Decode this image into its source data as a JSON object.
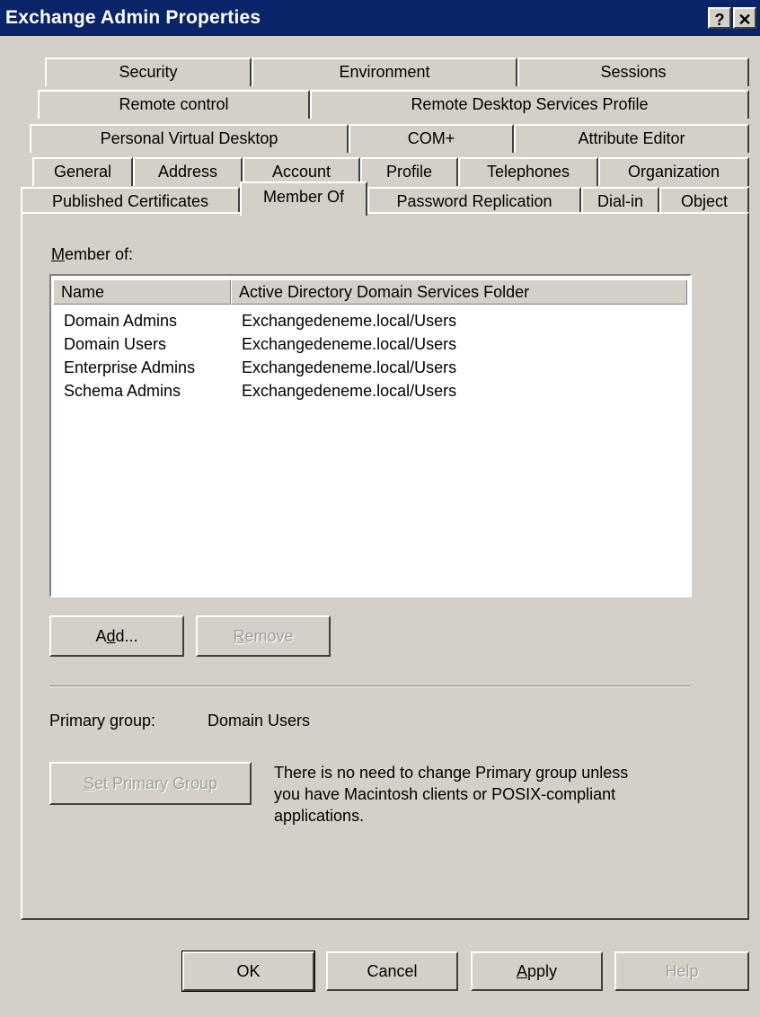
{
  "window": {
    "title": "Exchange Admin Properties",
    "help_glyph": "?",
    "close_glyph": "✕"
  },
  "tabs": {
    "row1": [
      "Security",
      "Environment",
      "Sessions"
    ],
    "row2": [
      "Remote control",
      "Remote Desktop Services Profile"
    ],
    "row3": [
      "Personal Virtual Desktop",
      "COM+",
      "Attribute Editor"
    ],
    "row4": [
      "General",
      "Address",
      "Account",
      "Profile",
      "Telephones",
      "Organization"
    ],
    "row5": [
      "Published Certificates",
      "Member Of",
      "Password Replication",
      "Dial-in",
      "Object"
    ],
    "selected": "Member Of"
  },
  "member_of": {
    "label_first": "M",
    "label_rest": "ember of:",
    "columns": [
      "Name",
      "Active Directory Domain Services Folder"
    ],
    "rows": [
      {
        "name": "Domain Admins",
        "folder": "Exchangedeneme.local/Users"
      },
      {
        "name": "Domain Users",
        "folder": "Exchangedeneme.local/Users"
      },
      {
        "name": "Enterprise Admins",
        "folder": "Exchangedeneme.local/Users"
      },
      {
        "name": "Schema Admins",
        "folder": "Exchangedeneme.local/Users"
      }
    ],
    "add_button": {
      "pre": "A",
      "u": "d",
      "post": "d..."
    },
    "remove_button": {
      "u": "R",
      "post": "emove",
      "enabled": false
    }
  },
  "primary_group": {
    "label": "Primary group:",
    "value": "Domain Users",
    "set_button": {
      "u": "S",
      "post": "et Primary Group",
      "enabled": false
    },
    "info_lines": [
      "There is no need to change Primary group unless",
      "you have Macintosh clients or POSIX-compliant",
      "applications."
    ]
  },
  "footer": {
    "ok": "OK",
    "cancel": "Cancel",
    "apply_u": "A",
    "apply_rest": "pply",
    "help": "Help",
    "help_enabled": false
  },
  "colors": {
    "dialog_face": "#d4d0c8",
    "titlebar": "#0a246a",
    "disabled_text": "#a0a0a0"
  }
}
